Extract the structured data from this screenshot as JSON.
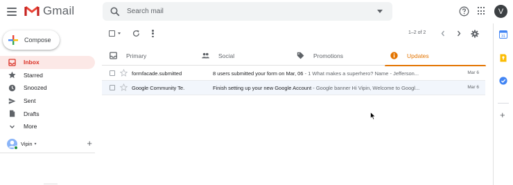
{
  "app": {
    "name": "Gmail"
  },
  "header": {
    "logo_text": "Gmail",
    "search_placeholder": "Search mail",
    "avatar_letter": "V"
  },
  "sidebar": {
    "compose_label": "Compose",
    "items": [
      {
        "label": "Inbox",
        "icon": "inbox-icon",
        "active": true
      },
      {
        "label": "Starred",
        "icon": "star-icon"
      },
      {
        "label": "Snoozed",
        "icon": "clock-icon"
      },
      {
        "label": "Sent",
        "icon": "send-icon"
      },
      {
        "label": "Drafts",
        "icon": "draft-icon"
      },
      {
        "label": "More",
        "icon": "chevron-down-icon"
      }
    ],
    "user": {
      "name": "Vipin",
      "caret": "▾",
      "add": "+"
    }
  },
  "toolbar": {
    "pager_text": "1–2 of 2"
  },
  "tabs": [
    {
      "label": "Primary",
      "icon": "inbox-tab-icon"
    },
    {
      "label": "Social",
      "icon": "people-icon"
    },
    {
      "label": "Promotions",
      "icon": "tag-icon"
    },
    {
      "label": "Updates",
      "icon": "info-icon",
      "active": true
    }
  ],
  "emails": [
    {
      "sender": "formfacade.submitted",
      "subject": "8 users submitted your form on Mar, 06",
      "snippet": " - 1 What makes a superhero? Name - Jefferson",
      "ellipsis": "...",
      "date": "Mar 6"
    },
    {
      "sender": "Google Community Te.",
      "subject": "Finish setting up your new Google Account",
      "snippet": " - Google banner Hi Vipin, Welcome to Googl",
      "ellipsis": "...",
      "date": "Mar 6"
    }
  ],
  "colors": {
    "accent_red": "#d93025",
    "active_nav_bg": "#fce8e6",
    "updates_orange": "#e37400",
    "read_row_bg": "#f2f6fc"
  }
}
